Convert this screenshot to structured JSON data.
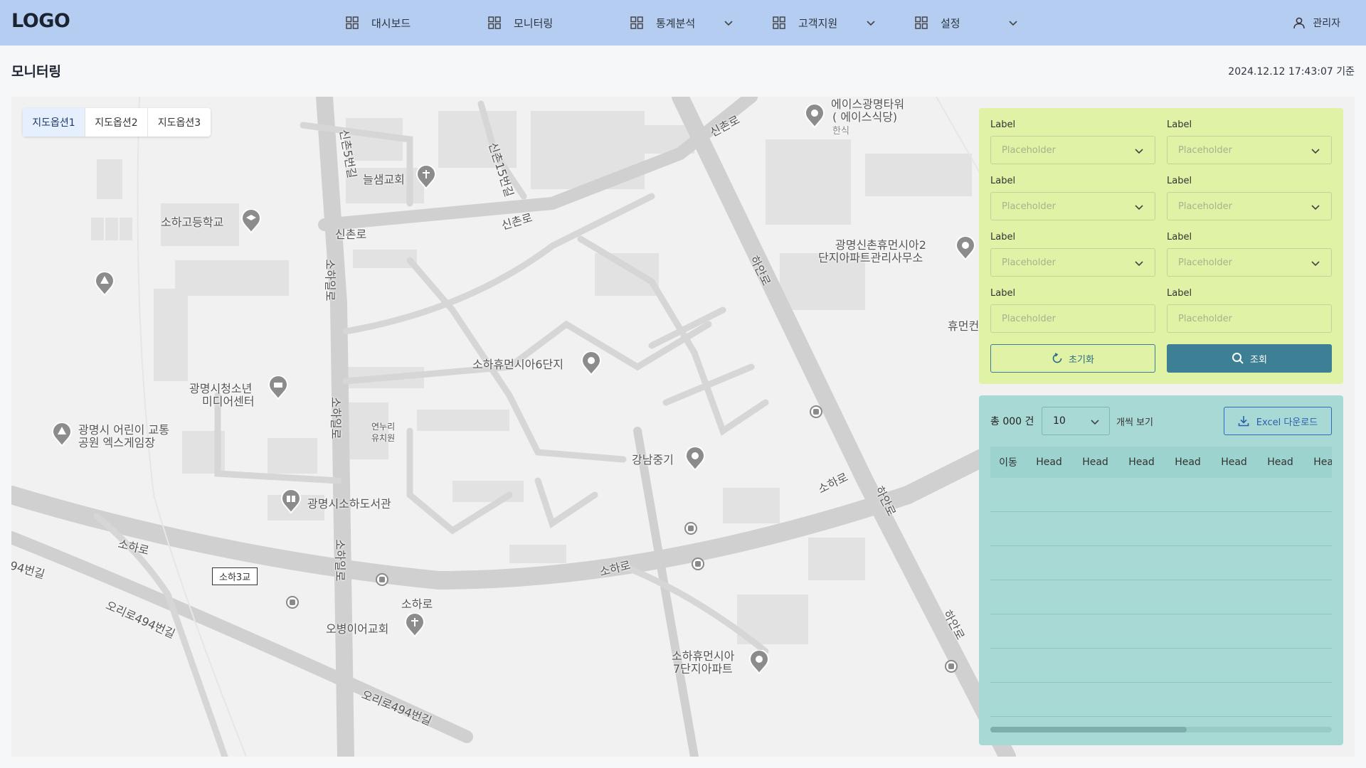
{
  "nav": {
    "logo": "LOGO",
    "items": [
      {
        "label": "대시보드",
        "has_dropdown": false
      },
      {
        "label": "모니터링",
        "has_dropdown": false
      },
      {
        "label": "통계분석",
        "has_dropdown": true
      },
      {
        "label": "고객지원",
        "has_dropdown": true
      },
      {
        "label": "설정",
        "has_dropdown": true
      }
    ],
    "user": "관리자"
  },
  "page": {
    "title": "모니터링",
    "timestamp": "2024.12.12 17:43:07 기준"
  },
  "map": {
    "tabs": [
      "지도옵션1",
      "지도옵션2",
      "지도옵션3"
    ],
    "active_tab": 0,
    "places": [
      "에이스광명타워",
      "( 에이스식당)",
      "한식",
      "늘샘교회",
      "소하고등학교",
      "광명신촌휴먼시아2",
      "단지아파트관리사무소",
      "휴먼컨",
      "소하휴먼시아6단지",
      "광명시청소년",
      "미디어센터",
      "광명시 어린이 교통",
      "공원 엑스게임장",
      "강남중기",
      "광명시소하도서관",
      "소하3교",
      "오병이어교회",
      "소하휴먼시아",
      "7단지아파트",
      "연누리",
      "유치원"
    ],
    "roads": [
      "신촌로",
      "신촌로",
      "신촌로",
      "신촌5번길",
      "신촌15번길",
      "소하일로",
      "소하일로",
      "소하일로",
      "하안로",
      "하안로",
      "하안로",
      "소하로",
      "소하로",
      "소하로",
      "소하로",
      "오리로494번길",
      "오리로494번길",
      "94번길"
    ]
  },
  "filter": {
    "fields": [
      {
        "label": "Label",
        "placeholder": "Placeholder",
        "type": "select"
      },
      {
        "label": "Label",
        "placeholder": "Placeholder",
        "type": "select"
      },
      {
        "label": "Label",
        "placeholder": "Placeholder",
        "type": "select"
      },
      {
        "label": "Label",
        "placeholder": "Placeholder",
        "type": "select"
      },
      {
        "label": "Label",
        "placeholder": "Placeholder",
        "type": "select"
      },
      {
        "label": "Label",
        "placeholder": "Placeholder",
        "type": "select"
      },
      {
        "label": "Label",
        "placeholder": "Placeholder",
        "type": "text"
      },
      {
        "label": "Label",
        "placeholder": "Placeholder",
        "type": "text"
      }
    ],
    "reset_label": "초기화",
    "search_label": "조회"
  },
  "result": {
    "total": "총 000 건",
    "per_page": "10",
    "per_page_text": "개씩 보기",
    "excel_label": "Excel 다운로드",
    "columns": [
      "이동",
      "Head",
      "Head",
      "Head",
      "Head",
      "Head",
      "Head",
      "Head"
    ],
    "row_count": 7,
    "scroll_fraction": 0.57
  },
  "colors": {
    "nav_bg": "#b4cdf0",
    "filter_bg": "#dff2a5",
    "result_bg": "#a8d9d4",
    "primary": "#3d7f94",
    "excel": "#2a5fb0"
  }
}
